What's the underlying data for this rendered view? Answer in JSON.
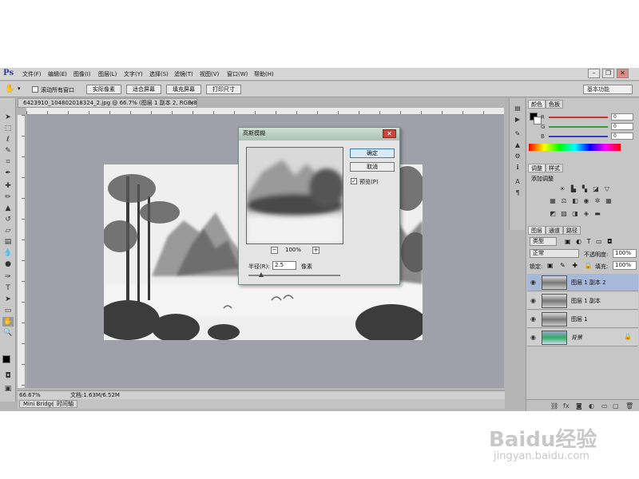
{
  "app": {
    "logo": "Ps"
  },
  "menu": [
    {
      "label": "文件(F)"
    },
    {
      "label": "编辑(E)"
    },
    {
      "label": "图像(I)"
    },
    {
      "label": "图层(L)"
    },
    {
      "label": "文字(Y)"
    },
    {
      "label": "选择(S)"
    },
    {
      "label": "滤镜(T)"
    },
    {
      "label": "视图(V)"
    },
    {
      "label": "窗口(W)"
    },
    {
      "label": "帮助(H)"
    }
  ],
  "window_buttons": {
    "minimize": "–",
    "restore": "❐",
    "close": "✕"
  },
  "options": {
    "scroll_all_label": "滚动所有窗口",
    "actual_pixels": "实际像素",
    "fit_screen": "适合屏幕",
    "fill_screen": "填充屏幕",
    "print_size": "打印尺寸",
    "workspace": "基本功能"
  },
  "document": {
    "tab_title": "6423910_104802018324_2.jpg @ 66.7% (图层 1 副本 2, RGB/8#) *",
    "close": "×",
    "zoom": "66.67%",
    "doc_size": "文档:1.63M/6.52M"
  },
  "bottom_tabs": [
    {
      "label": "Mini Bridge"
    },
    {
      "label": "时间轴"
    }
  ],
  "dialog": {
    "title": "高斯模糊",
    "ok": "确定",
    "cancel": "取消",
    "preview_label": "预览(P)",
    "preview_checked": "✓",
    "zoom_out": "−",
    "zoom_in": "+",
    "zoom_value": "100%",
    "radius_label": "半径(R):",
    "radius_value": "2.5",
    "radius_unit": "像素"
  },
  "color_panel": {
    "tabs": [
      "颜色",
      "色板"
    ],
    "channels": [
      {
        "label": "R",
        "value": "0",
        "color": "#d03030"
      },
      {
        "label": "G",
        "value": "0",
        "color": "#30a030"
      },
      {
        "label": "B",
        "value": "0",
        "color": "#3040c0"
      }
    ]
  },
  "adjust_panel": {
    "tabs": [
      "调整",
      "样式"
    ],
    "add_label": "添加调整"
  },
  "layers_panel": {
    "tabs": [
      "图层",
      "通道",
      "路径"
    ],
    "filter": "类型",
    "blend_mode": "正常",
    "opacity_label": "不透明度:",
    "opacity_value": "100%",
    "lock_label": "锁定:",
    "fill_label": "填充:",
    "fill_value": "100%",
    "layers": [
      {
        "name": "图层 1 副本 2",
        "active": true
      },
      {
        "name": "图层 1 副本"
      },
      {
        "name": "图层 1"
      },
      {
        "name": "背景",
        "locked": true
      }
    ]
  },
  "watermark": {
    "brand": "Baidu经验",
    "url": "jingyan.baidu.com"
  }
}
